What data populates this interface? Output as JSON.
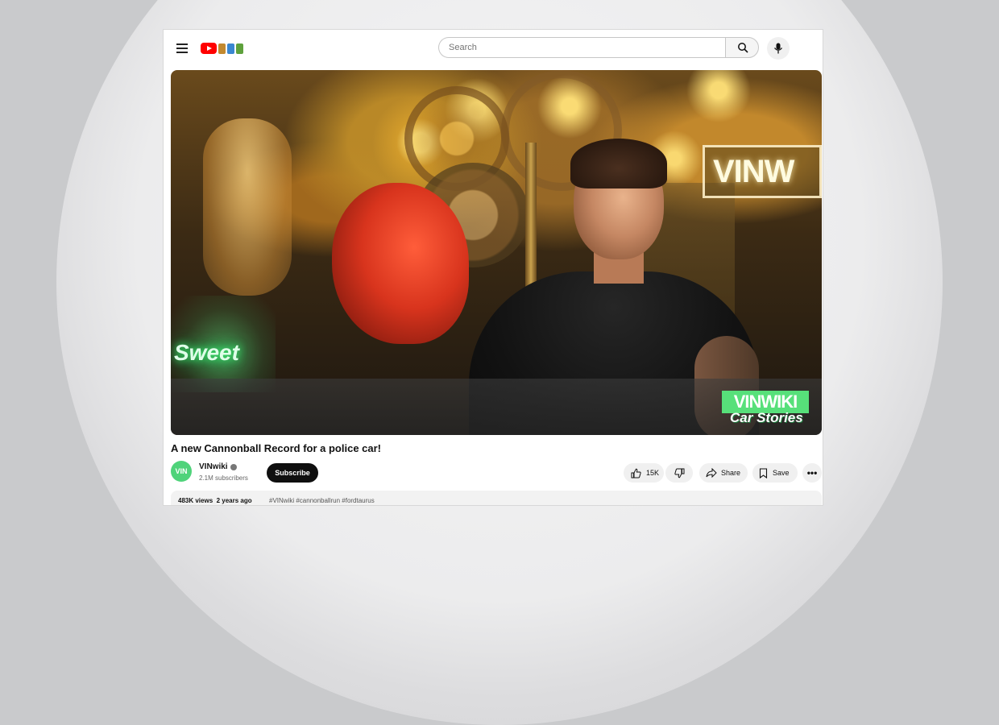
{
  "header": {
    "search_placeholder": "Search"
  },
  "video": {
    "sign_text": "VINW",
    "neon_text": "Sweet",
    "brand_top": "VINWIKI",
    "brand_bottom": "Car Stories"
  },
  "watch": {
    "title": "A new Cannonball Record for a police car!",
    "channel": {
      "avatar_text": "VIN",
      "name": "VINwiki",
      "subscribers": "2.1M subscribers"
    },
    "subscribe_label": "Subscribe",
    "like_count": "15K",
    "share_label": "Share",
    "save_label": "Save",
    "more_label": "•••",
    "views": "483K views",
    "age": "2 years ago",
    "tags": "#VINwiki #cannonballrun #fordtaurus"
  },
  "colors": {
    "brand_red": "#ff0000",
    "brand_green": "#57e07a"
  }
}
